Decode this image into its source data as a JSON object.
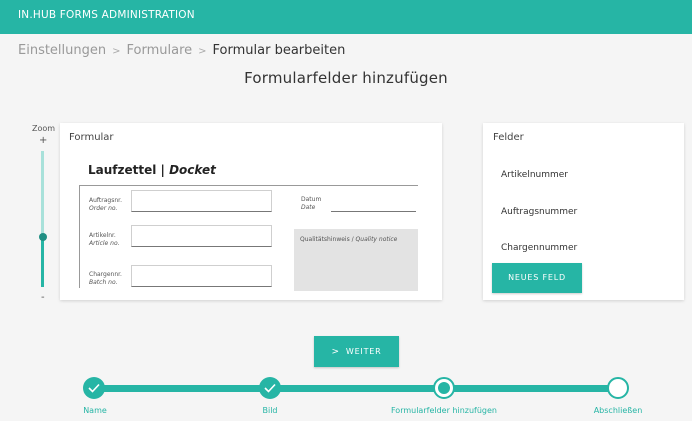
{
  "app": {
    "title": "IN.HUB FORMS ADMINISTRATION"
  },
  "breadcrumb": {
    "items": [
      "Einstellungen",
      "Formulare"
    ],
    "current": "Formular bearbeiten"
  },
  "page_title": "Formularfelder hinzufügen",
  "zoom": {
    "label": "Zoom",
    "plus": "+",
    "minus": "-",
    "level": 0.37
  },
  "form_card": {
    "title": "Formular",
    "doc_title_main": "Laufzettel | ",
    "doc_title_italic": "Docket",
    "fields": [
      {
        "label": "Auftragsnr.",
        "label_en": "Order no."
      },
      {
        "label": "Artikelnr.",
        "label_en": "Article no."
      },
      {
        "label": "Chargennr.",
        "label_en": "Batch no."
      }
    ],
    "date": {
      "label": "Datum",
      "label_en": "Date"
    },
    "quality": {
      "label": "Qualitätshinweis / ",
      "label_en": "Quality notice"
    }
  },
  "fields_card": {
    "title": "Felder",
    "items": [
      "Artikelnummer",
      "Auftragsnummer",
      "Chargennummer"
    ],
    "new_button": "NEUES FELD"
  },
  "next_button": {
    "label": "WEITER",
    "icon": "chevron-right-icon"
  },
  "stepper": {
    "steps": [
      {
        "label": "Name",
        "state": "done"
      },
      {
        "label": "Bild",
        "state": "done"
      },
      {
        "label": "Formularfelder hinzufügen",
        "state": "active"
      },
      {
        "label": "Abschließen",
        "state": "todo"
      }
    ]
  },
  "colors": {
    "accent": "#26b5a5",
    "accent_light": "#a8e1da",
    "background": "#f5f5f5"
  }
}
